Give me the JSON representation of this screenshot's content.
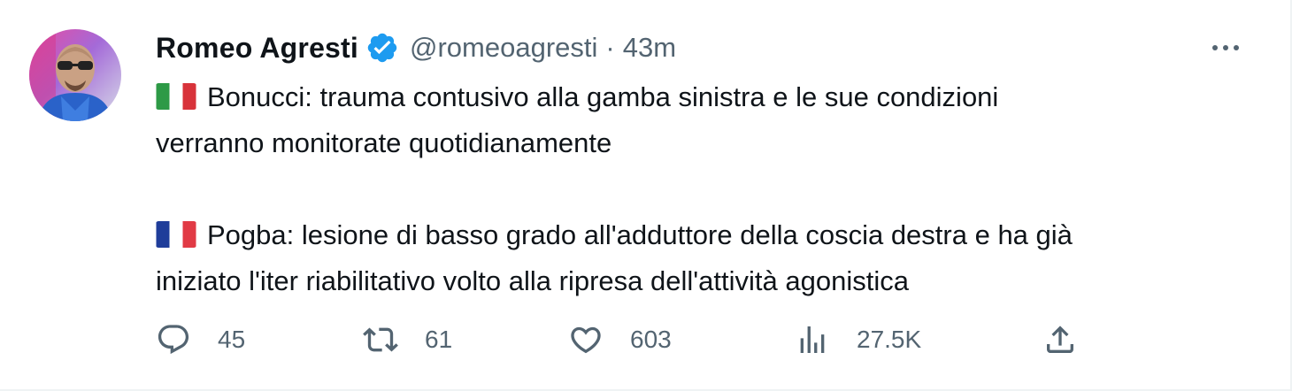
{
  "tweet": {
    "author": {
      "display_name": "Romeo Agresti",
      "handle": "@romeoagresti",
      "separator": "·",
      "time": "43m",
      "verified": true,
      "avatar_icon": "avatar-photo"
    },
    "paragraphs": [
      {
        "flag": "italy-flag",
        "lines": [
          "Bonucci: trauma contusivo alla gamba sinistra e le sue condizioni",
          "verranno monitorate quotidianamente"
        ]
      },
      {
        "flag": "france-flag",
        "lines": [
          "Pogba: lesione di basso grado all'adduttore della coscia destra e ha già",
          "iniziato l'iter riabilitativo volto alla ripresa dell'attività agonistica"
        ]
      }
    ],
    "actions": {
      "reply": {
        "icon": "reply-icon",
        "count": "45"
      },
      "retweet": {
        "icon": "retweet-icon",
        "count": "61"
      },
      "like": {
        "icon": "heart-icon",
        "count": "603"
      },
      "views": {
        "icon": "views-icon",
        "count": "27.5K"
      },
      "share": {
        "icon": "share-icon"
      }
    },
    "more_icon": "more-icon"
  },
  "colors": {
    "text": "#0f1419",
    "secondary": "#536471",
    "verified_blue": "#1d9bf0",
    "border": "#eff3f4"
  }
}
